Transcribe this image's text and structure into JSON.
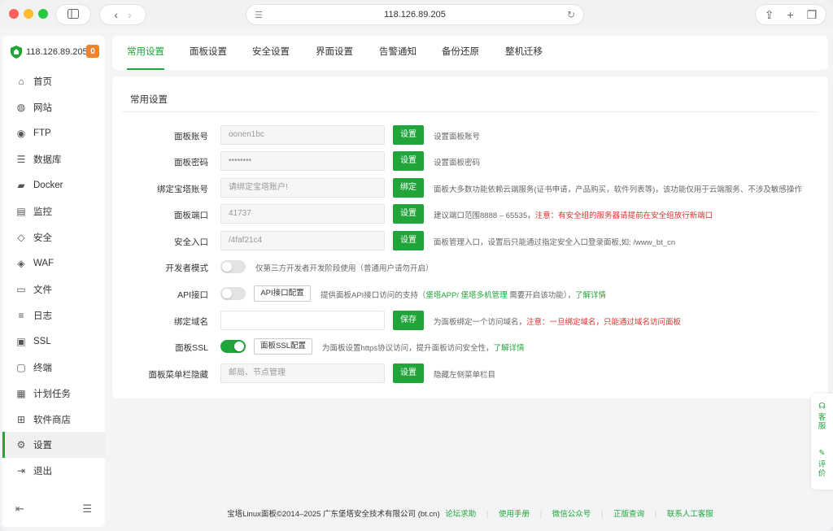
{
  "browser": {
    "url": "118.126.89.205"
  },
  "sidebar": {
    "server": "118.126.89.205",
    "badge": "0",
    "items": [
      {
        "label": "首页",
        "icon": "home-icon"
      },
      {
        "label": "网站",
        "icon": "globe-icon"
      },
      {
        "label": "FTP",
        "icon": "ftp-icon"
      },
      {
        "label": "数据库",
        "icon": "database-icon"
      },
      {
        "label": "Docker",
        "icon": "docker-icon"
      },
      {
        "label": "监控",
        "icon": "monitor-icon"
      },
      {
        "label": "安全",
        "icon": "shield-icon"
      },
      {
        "label": "WAF",
        "icon": "waf-icon"
      },
      {
        "label": "文件",
        "icon": "folder-icon"
      },
      {
        "label": "日志",
        "icon": "log-icon"
      },
      {
        "label": "SSL",
        "icon": "ssl-icon"
      },
      {
        "label": "终端",
        "icon": "terminal-icon"
      },
      {
        "label": "计划任务",
        "icon": "task-icon"
      },
      {
        "label": "软件商店",
        "icon": "grid-icon"
      },
      {
        "label": "设置",
        "icon": "gear-icon"
      },
      {
        "label": "退出",
        "icon": "logout-icon"
      }
    ],
    "active": "设置"
  },
  "tabs": [
    "常用设置",
    "面板设置",
    "安全设置",
    "界面设置",
    "告警通知",
    "备份还原",
    "整机迁移"
  ],
  "panel": {
    "title": "常用设置",
    "rows": {
      "account": {
        "label": "面板账号",
        "value": "oonen1bc",
        "button": "设置",
        "hint": "设置面板账号"
      },
      "password": {
        "label": "面板密码",
        "value": "••••••••",
        "button": "设置",
        "hint": "设置面板密码"
      },
      "bind": {
        "label": "绑定宝塔账号",
        "placeholder": "请绑定宝塔账户!",
        "button": "绑定",
        "hint": "面板大多数功能依赖云端服务(证书申请，产品购买，软件列表等)，该功能仅用于云端服务、不涉及敏感操作"
      },
      "port": {
        "label": "面板端口",
        "value": "41737",
        "button": "设置",
        "hint": "建议端口范围8888 – 65535，",
        "hint_red": "注意：有安全组的服务器请提前在安全组放行新端口"
      },
      "entry": {
        "label": "安全入口",
        "value": "/4faf21c4",
        "button": "设置",
        "hint": "面板管理入口，设置后只能通过指定安全入口登录面板,如: /www_bt_cn"
      },
      "dev": {
        "label": "开发者模式",
        "hint": "仅第三方开发者开发阶段使用（普通用户请勿开启）",
        "enabled": false
      },
      "api": {
        "label": "API接口",
        "button": "API接口配置",
        "hint_a": "提供面板API接口访问的支持（",
        "link1": "堡塔APP/",
        "link2": "堡塔多机管理",
        "hint_b": "需要开启该功能），",
        "link3": "了解详情",
        "enabled": false
      },
      "domain": {
        "label": "绑定域名",
        "value": "",
        "button": "保存",
        "hint": "为面板绑定一个访问域名，",
        "hint_red": "注意：一旦绑定域名，只能通过域名访问面板"
      },
      "ssl": {
        "label": "面板SSL",
        "button": "面板SSL配置",
        "hint": "为面板设置https协议访问，提升面板访问安全性，",
        "link": "了解详情",
        "enabled": true
      },
      "hide": {
        "label": "面板菜单栏隐藏",
        "placeholder": "邮局、节点管理",
        "button": "设置",
        "hint": "隐藏左侧菜单栏目"
      }
    }
  },
  "footer": {
    "copyright": "宝塔Linux面板©2014–2025 广东堡塔安全技术有限公司 (bt.cn)",
    "links": [
      "论坛求助",
      "使用手册",
      "微信公众号",
      "正版查询",
      "联系人工客服"
    ]
  },
  "float": {
    "service": "客服",
    "feedback": "评价"
  },
  "colors": {
    "accent": "#20a53a",
    "warning": "#e0312d",
    "badge": "#f0842c"
  }
}
